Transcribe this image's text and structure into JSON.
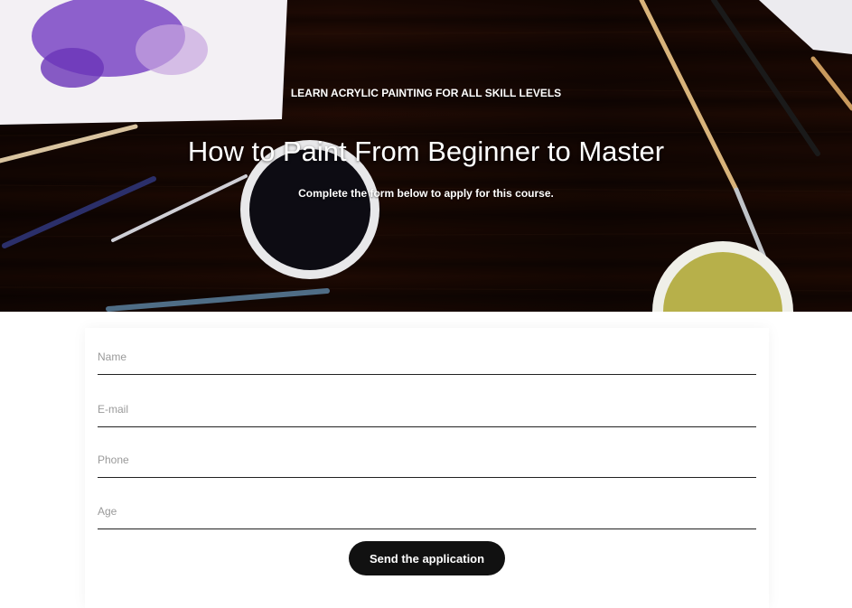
{
  "hero": {
    "eyebrow": "LEARN ACRYLIC PAINTING FOR ALL SKILL LEVELS",
    "title": "How to Paint From Beginner to Master",
    "subtitle": "Complete the form below to apply for this course."
  },
  "form": {
    "fields": [
      {
        "placeholder": "Name",
        "value": ""
      },
      {
        "placeholder": "E-mail",
        "value": ""
      },
      {
        "placeholder": "Phone",
        "value": ""
      },
      {
        "placeholder": "Age",
        "value": ""
      }
    ],
    "submit_label": "Send the application"
  },
  "colors": {
    "button_bg": "#111111",
    "text_on_hero": "#ffffff",
    "field_underline": "#222222"
  }
}
